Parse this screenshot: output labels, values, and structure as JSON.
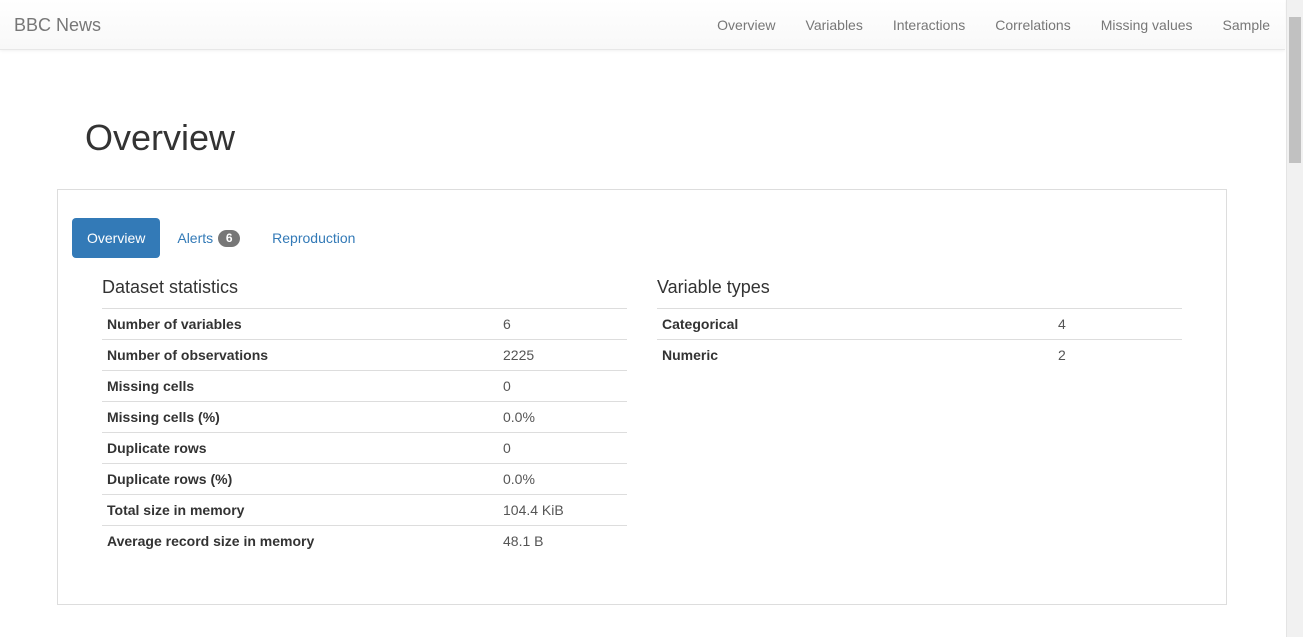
{
  "navbar": {
    "brand": "BBC News",
    "links": [
      "Overview",
      "Variables",
      "Interactions",
      "Correlations",
      "Missing values",
      "Sample"
    ]
  },
  "page": {
    "title": "Overview"
  },
  "tabs": {
    "overview": "Overview",
    "alerts": "Alerts",
    "alerts_count": "6",
    "reproduction": "Reproduction"
  },
  "dataset_statistics": {
    "title": "Dataset statistics",
    "rows": [
      {
        "label": "Number of variables",
        "value": "6"
      },
      {
        "label": "Number of observations",
        "value": "2225"
      },
      {
        "label": "Missing cells",
        "value": "0"
      },
      {
        "label": "Missing cells (%)",
        "value": "0.0%"
      },
      {
        "label": "Duplicate rows",
        "value": "0"
      },
      {
        "label": "Duplicate rows (%)",
        "value": "0.0%"
      },
      {
        "label": "Total size in memory",
        "value": "104.4 KiB"
      },
      {
        "label": "Average record size in memory",
        "value": "48.1 B"
      }
    ]
  },
  "variable_types": {
    "title": "Variable types",
    "rows": [
      {
        "label": "Categorical",
        "value": "4"
      },
      {
        "label": "Numeric",
        "value": "2"
      }
    ]
  },
  "colors": {
    "accent": "#337ab7",
    "badge": "#777777",
    "nav_text": "#777777"
  }
}
